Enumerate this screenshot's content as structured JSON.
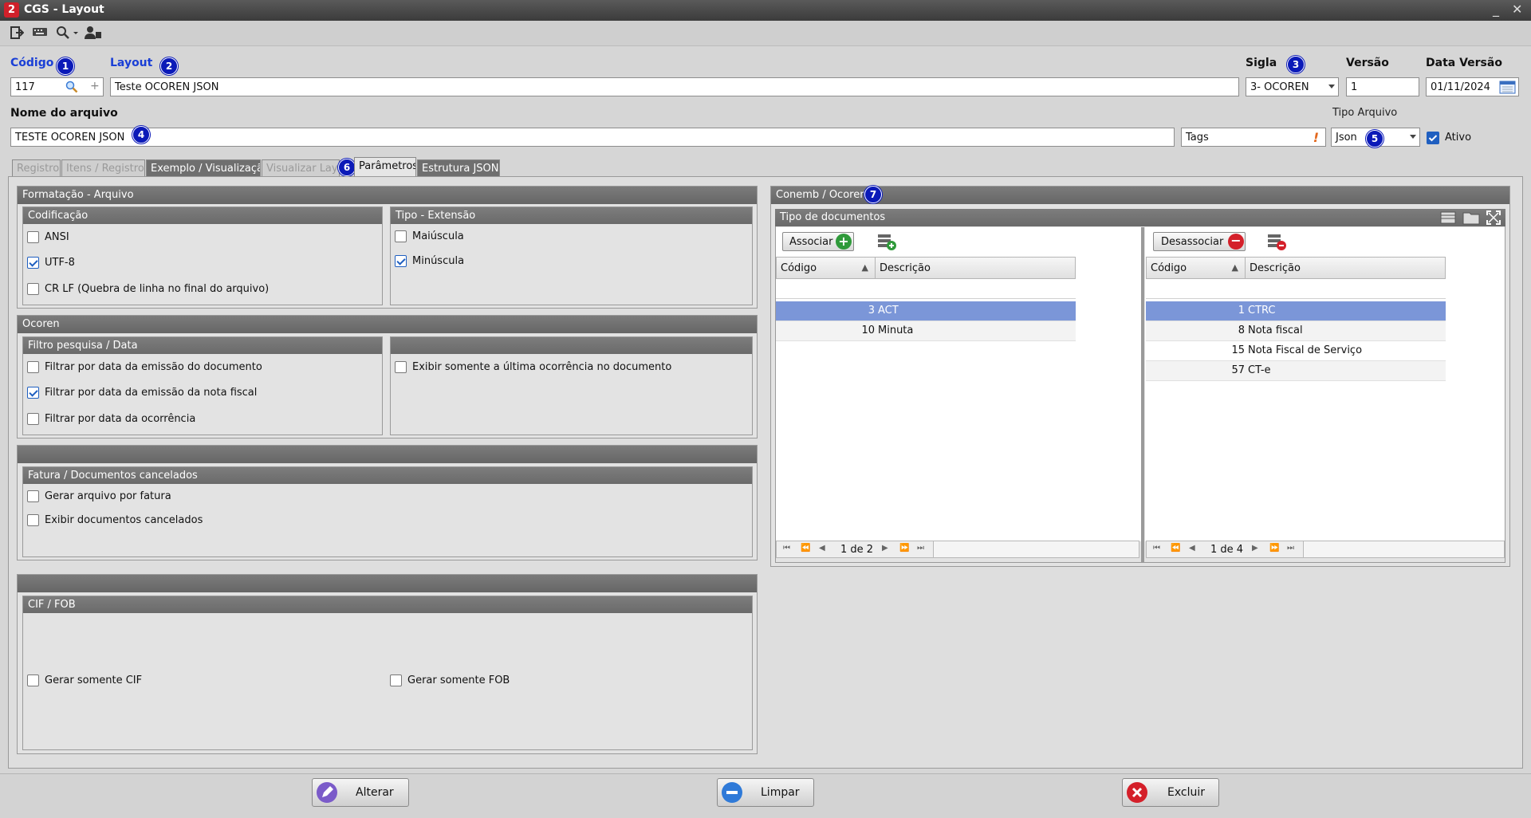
{
  "window": {
    "title": "CGS - Layout",
    "logo_glyph": "2",
    "minimize_glyph": "_",
    "close_glyph": "✕"
  },
  "toolbar": {
    "icons": [
      "exit-icon",
      "keyboard-icon",
      "search-dropdown-icon",
      "user-card-icon"
    ]
  },
  "header": {
    "codigo_label": "Código",
    "codigo_value": "117",
    "codigo_plus": "+",
    "layout_label": "Layout",
    "layout_value": "Teste OCOREN JSON",
    "sigla_label": "Sigla",
    "sigla_value": "3- OCOREN",
    "versao_label": "Versão",
    "versao_value": "1",
    "data_versao_label": "Data Versão",
    "data_versao_value": "01/11/2024",
    "nome_arquivo_label": "Nome do arquivo",
    "nome_arquivo_value": "TESTE OCOREN JSON",
    "tags_value": "Tags",
    "tags_warning": "!",
    "tipo_arquivo_label": "Tipo Arquivo",
    "tipo_arquivo_value": "Json",
    "ativo_label": "Ativo",
    "ativo_checked": true
  },
  "badges": [
    "1",
    "2",
    "3",
    "4",
    "5",
    "6",
    "7"
  ],
  "tabs": [
    {
      "label": "Registros",
      "state": "disabled"
    },
    {
      "label": "Itens / Registros",
      "state": "disabled"
    },
    {
      "label": "Exemplo / Visualização",
      "state": "normal"
    },
    {
      "label": "Visualizar Layout",
      "state": "disabled"
    },
    {
      "label": "Parâmetros",
      "state": "active"
    },
    {
      "label": "Estrutura JSON",
      "state": "normal"
    }
  ],
  "formatacao": {
    "title": "Formatação - Arquivo",
    "codificacao": {
      "title": "Codificação",
      "options": [
        {
          "label": "ANSI",
          "checked": false
        },
        {
          "label": "UTF-8",
          "checked": true
        },
        {
          "label": "CR LF (Quebra de linha no final do arquivo)",
          "checked": false
        }
      ]
    },
    "tipo_extensao": {
      "title": "Tipo - Extensão",
      "options": [
        {
          "label": "Maiúscula",
          "checked": false
        },
        {
          "label": "Minúscula",
          "checked": true
        }
      ]
    }
  },
  "ocoren": {
    "title": "Ocoren",
    "filtro": {
      "title": "Filtro pesquisa / Data",
      "options": [
        {
          "label": "Filtrar por data da emissão do documento",
          "checked": false
        },
        {
          "label": "Filtrar por data da emissão da nota fiscal",
          "checked": true
        },
        {
          "label": "Filtrar por data da ocorrência",
          "checked": false
        }
      ]
    },
    "exibir": {
      "label": "Exibir somente a última ocorrência no documento",
      "checked": false
    }
  },
  "fatura": {
    "title": "Fatura / Documentos cancelados",
    "options": [
      {
        "label": "Gerar arquivo por fatura",
        "checked": false
      },
      {
        "label": "Exibir documentos cancelados",
        "checked": false
      }
    ]
  },
  "ciffob": {
    "title": "CIF / FOB",
    "cif_label": "Gerar somente CIF",
    "fob_label": "Gerar somente FOB"
  },
  "conemb": {
    "title": "Conemb / Ocoren",
    "tipo_documentos_title": "Tipo de documentos",
    "associar_label": "Associar",
    "desassociar_label": "Desassociar",
    "col_codigo": "Código",
    "col_descricao": "Descrição",
    "sort_glyph": "▲",
    "left_rows": [
      {
        "codigo": "3",
        "descricao": "ACT",
        "selected": true
      },
      {
        "codigo": "10",
        "descricao": "Minuta",
        "selected": false
      }
    ],
    "right_rows": [
      {
        "codigo": "1",
        "descricao": "CTRC",
        "selected": true
      },
      {
        "codigo": "8",
        "descricao": "Nota fiscal",
        "selected": false
      },
      {
        "codigo": "15",
        "descricao": "Nota Fiscal de Serviço",
        "selected": false
      },
      {
        "codigo": "57",
        "descricao": "CT-e",
        "selected": false
      }
    ],
    "left_page": "1 de 2",
    "right_page": "1 de 4"
  },
  "footer": {
    "alterar_label": "Alterar",
    "limpar_label": "Limpar",
    "excluir_label": "Excluir"
  },
  "colors": {
    "accent_blue": "#1a3fd6",
    "badge_blue": "#0b1ab8",
    "selection": "#7b96d8",
    "header_gray": "#6f6f6f"
  }
}
